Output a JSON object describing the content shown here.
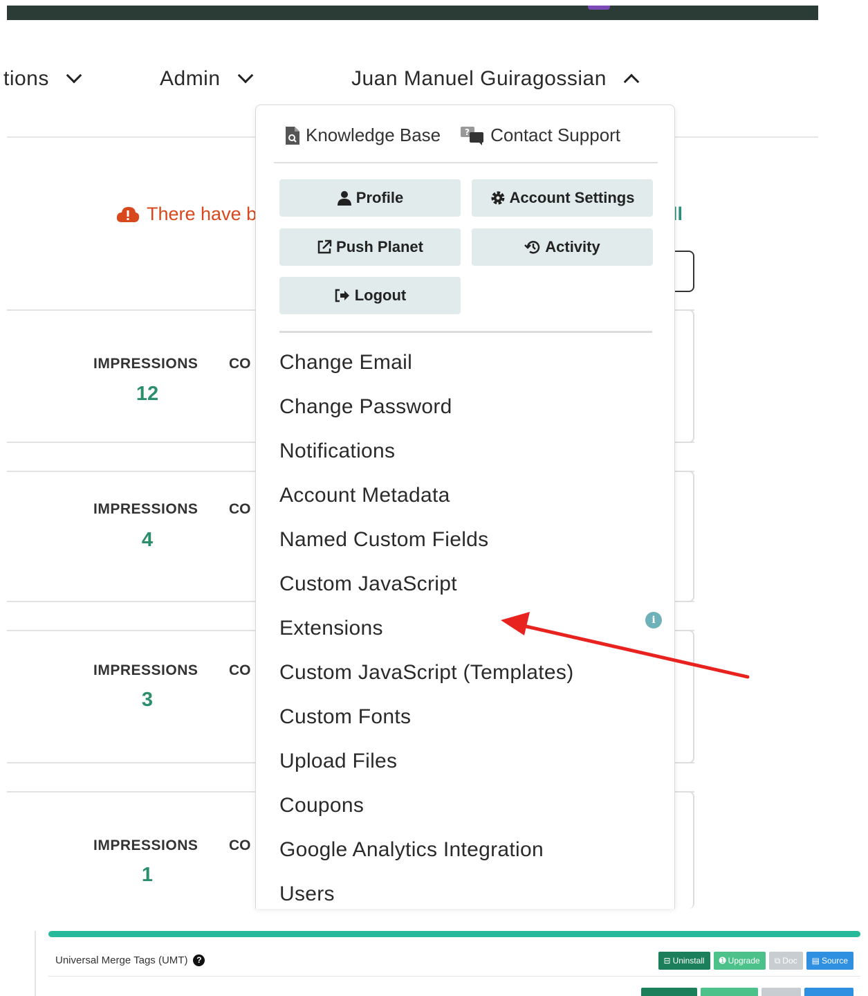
{
  "nav": {
    "item1_label": "tions",
    "item2_label": "Admin",
    "user_label": "Juan Manuel Guiragossian"
  },
  "alert": {
    "text": "There have b",
    "link_text": "ll"
  },
  "cards": [
    {
      "metric_label": "IMPRESSIONS",
      "metric_value": "12",
      "second_label": "CO"
    },
    {
      "metric_label": "IMPRESSIONS",
      "metric_value": "4",
      "second_label": "CO"
    },
    {
      "metric_label": "IMPRESSIONS",
      "metric_value": "3",
      "second_label": "CO"
    },
    {
      "metric_label": "IMPRESSIONS",
      "metric_value": "1",
      "second_label": "CO"
    }
  ],
  "dropdown": {
    "knowledge_base": "Knowledge Base",
    "contact_support": "Contact Support",
    "buttons": {
      "profile": "Profile",
      "account_settings": "Account Settings",
      "push_planet": "Push Planet",
      "activity": "Activity",
      "logout": "Logout"
    },
    "menu_items": [
      "Change Email",
      "Change Password",
      "Notifications",
      "Account Metadata",
      "Named Custom Fields",
      "Custom JavaScript",
      "Extensions",
      "Custom JavaScript (Templates)",
      "Custom Fonts",
      "Upload Files",
      "Coupons",
      "Google Analytics Integration",
      "Users"
    ],
    "info_glyph": "i"
  },
  "extensions": {
    "row1_name": "Universal Merge Tags (UMT)",
    "help_glyph": "?",
    "buttons": {
      "uninstall": "Uninstall",
      "upgrade": "Upgrade",
      "doc": "Doc",
      "source": "Source"
    }
  },
  "colors": {
    "topbar": "#2b3b35",
    "alert": "#d9481c",
    "accent_green": "#2a8f6a",
    "dropdown_button": "#e1ebeb",
    "annotation_arrow": "#e8231f",
    "extension_bar": "#26b99a"
  }
}
